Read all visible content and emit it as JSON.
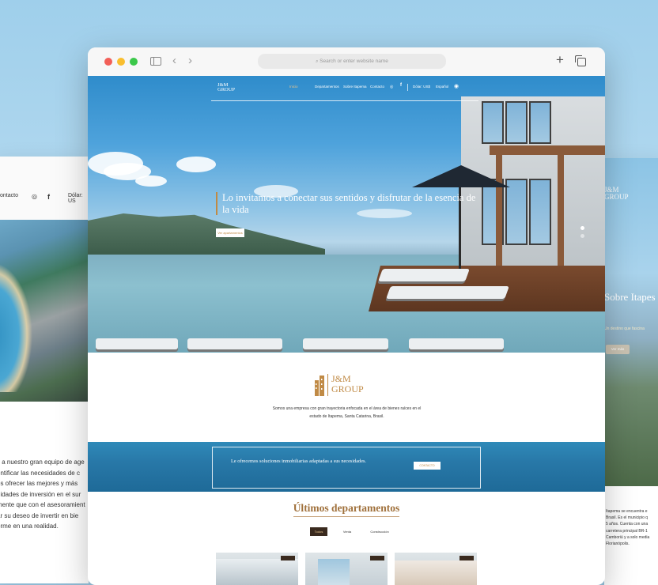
{
  "left_sheet": {
    "nav": {
      "contact": "ontacto",
      "currency": "Dólar: US"
    },
    "paragraph_lines": [
      "s a nuestro gran equipo de age",
      "entificar las necesidades de c",
      "os ofrecer las mejores y más",
      "nidades de inversión en el sur",
      "mente que con el asesoramient",
      "ar su deseo de invertir en bie",
      "orme en una realidad."
    ]
  },
  "right_sheet": {
    "logo": [
      "J&M",
      "GROUP"
    ],
    "title": "Sobre Itapes",
    "subtitle": "Un destino que fascina",
    "button": "Ver más",
    "paragraph_lines": [
      "Itapema se encuentra e",
      "Brasil. Es el municipio q",
      "5 años. Cuenta con una",
      "carretera principal BR-1",
      "Camboriú y a solo media",
      "Florianópolis."
    ]
  },
  "browser": {
    "url_placeholder": "Search or enter website name",
    "new_tab_icon": "plus-icon",
    "tabs_icon": "tabs-icon"
  },
  "site": {
    "logo": {
      "line1": "J&M",
      "line2": "GROUP"
    },
    "nav": {
      "items": [
        "Inicio",
        "Departamentos",
        "Sobre Itapema",
        "Contacto"
      ],
      "currency": "Dólar: US$",
      "language": "Español"
    },
    "hero": {
      "title": "Lo invitamos a conectar sus sentidos y disfrutar de la esencia de la vida",
      "button": "Ver apartamentos"
    },
    "about": {
      "logo": {
        "line1": "J&M",
        "line2": "GROUP"
      },
      "text": "Somos una empresa con gran trayectoria enfocada en el área de bienes raíces en el estado de Itapema, Santa Catarina, Brasil."
    },
    "band": {
      "text": "Le ofrecemos soluciones inmobiliarias adaptadas a sus necesidades.",
      "button": "CONTACTO"
    },
    "listings": {
      "title": "Últimos departamentos",
      "filters": [
        "Todos",
        "Venta",
        "Construcción"
      ]
    }
  },
  "colors": {
    "accent": "#c08a45",
    "title_gold": "#a0713c",
    "dark": "#3a2a1e"
  }
}
